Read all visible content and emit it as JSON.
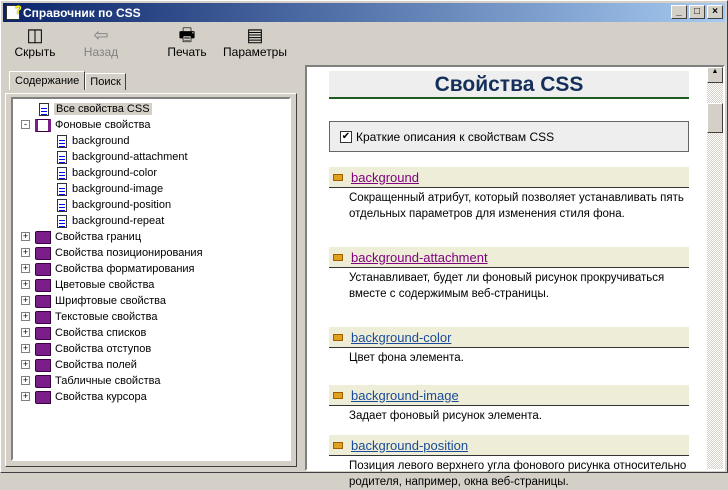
{
  "window": {
    "title": "Справочник по CSS",
    "min": "_",
    "max": "□",
    "close": "×"
  },
  "toolbar": [
    {
      "label": "Скрыть",
      "icon": "hide-icon",
      "disabled": false
    },
    {
      "label": "Назад",
      "icon": "back-arrow-icon",
      "disabled": true
    },
    {
      "label": "Печать",
      "icon": "printer-icon",
      "disabled": false
    },
    {
      "label": "Параметры",
      "icon": "options-icon",
      "disabled": false
    }
  ],
  "tabs": {
    "contents": "Содержание",
    "search": "Поиск"
  },
  "tree": {
    "all": "Все свойства CSS",
    "background_group": "Фоновые свойства",
    "background_children": [
      "background",
      "background-attachment",
      "background-color",
      "background-image",
      "background-position",
      "background-repeat"
    ],
    "groups": [
      "Свойства границ",
      "Свойства позиционирования",
      "Свойства форматирования",
      "Цветовые свойства",
      "Шрифтовые свойства",
      "Текстовые свойства",
      "Свойства списков",
      "Свойства отступов",
      "Свойства полей",
      "Табличные свойства",
      "Свойства курсора"
    ]
  },
  "content": {
    "title": "Свойства CSS",
    "checkbox_label": "Краткие описания к свойствам CSS",
    "checkbox_checked": true,
    "entries": [
      {
        "name": "background",
        "visited": true,
        "desc": "Сокращенный атрибут, который позволяет устанавливать пять отдельных параметров для изменения стиля фона."
      },
      {
        "name": "background-attachment",
        "visited": true,
        "desc": "Устанавливает, будет ли фоновый рисунок прокручиваться вместе с содержимым веб-страницы."
      },
      {
        "name": "background-color",
        "visited": false,
        "desc": "Цвет фона элемента."
      },
      {
        "name": "background-image",
        "visited": false,
        "desc": "Задает фоновый рисунок элемента."
      },
      {
        "name": "background-position",
        "visited": false,
        "desc": "Позиция левого верхнего угла фонового рисунка относительно родителя, например, окна веб-страницы."
      }
    ]
  },
  "colors": {
    "visited": "#800080",
    "link": "#1a4a9a",
    "title": "#14305a"
  }
}
